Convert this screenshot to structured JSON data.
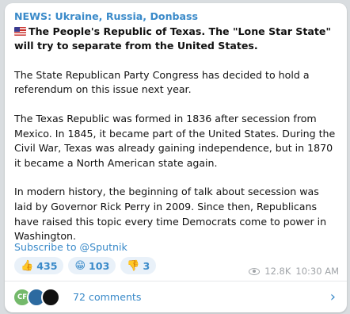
{
  "post": {
    "channel_title": "NEWS: Ukraine, Russia, Donbass",
    "headline": "The People's Republic of Texas. The \"Lone Star State\" will try to separate from the United States.",
    "paragraphs": [
      "The State Republican Party Congress has decided to hold a referendum on this issue next year.",
      "The Texas Republic was formed in 1836 after secession from Mexico. In 1845, it became part of the United States. During the Civil War, Texas was already gaining independence, but in 1870 it became a North American state again.",
      "In modern history, the beginning of talk about secession was laid by Governor Rick Perry in 2009. Since then, Republicans have raised this topic every time Democrats come to power in Washington."
    ],
    "subscribe_link": "Subscribe to @Sputnik"
  },
  "reactions": [
    {
      "emoji": "👍",
      "count": "435"
    },
    {
      "emoji": "😁",
      "count": "103"
    },
    {
      "emoji": "👎",
      "count": "3"
    }
  ],
  "meta": {
    "views": "12.8K",
    "time": "10:30 AM"
  },
  "comments": {
    "label": "72 comments",
    "avatars": [
      "CF",
      "",
      ""
    ]
  },
  "colors": {
    "link": "#3a8ac9",
    "reaction_bg": "#e9f1f9",
    "meta": "#a0a4a8"
  },
  "icons": [
    "us-flag-icon",
    "eye-icon",
    "chevron-right-icon"
  ]
}
